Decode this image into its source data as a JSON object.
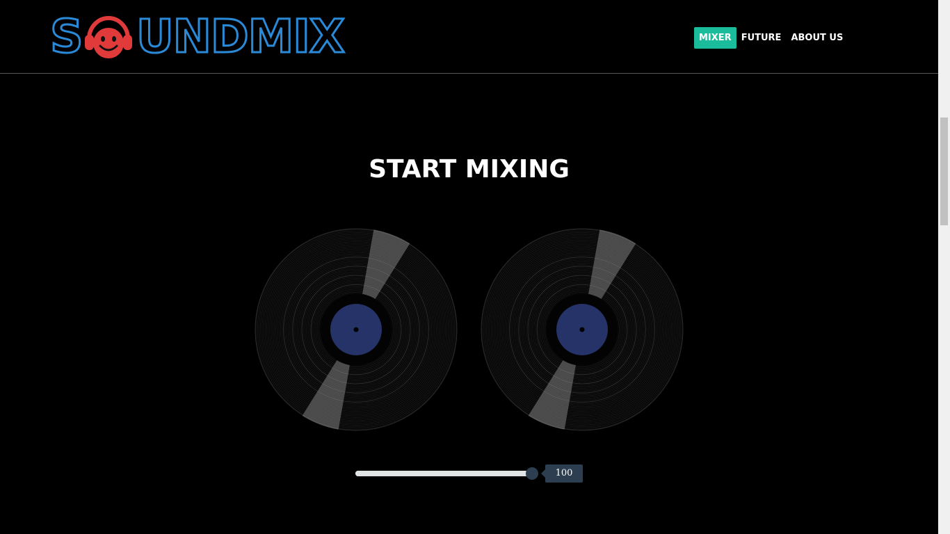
{
  "header": {
    "logo": {
      "text_before": "S",
      "text_after": "UNDMIX",
      "alt": "SOUNDMIX"
    },
    "nav": [
      {
        "label": "MIXER",
        "active": true
      },
      {
        "label": "FUTURE",
        "active": false
      },
      {
        "label": "ABOUT US",
        "active": false
      }
    ]
  },
  "main": {
    "title": "START MIXING",
    "records": [
      {
        "label_color": "#253368"
      },
      {
        "label_color": "#253368"
      }
    ],
    "volume": {
      "value": 100,
      "display": "100",
      "max": 100
    }
  },
  "colors": {
    "accent": "#1abc9c",
    "logo_blue": "#2a8ad8",
    "logo_red": "#e03a3a",
    "slider_dark": "#2c3e50"
  }
}
